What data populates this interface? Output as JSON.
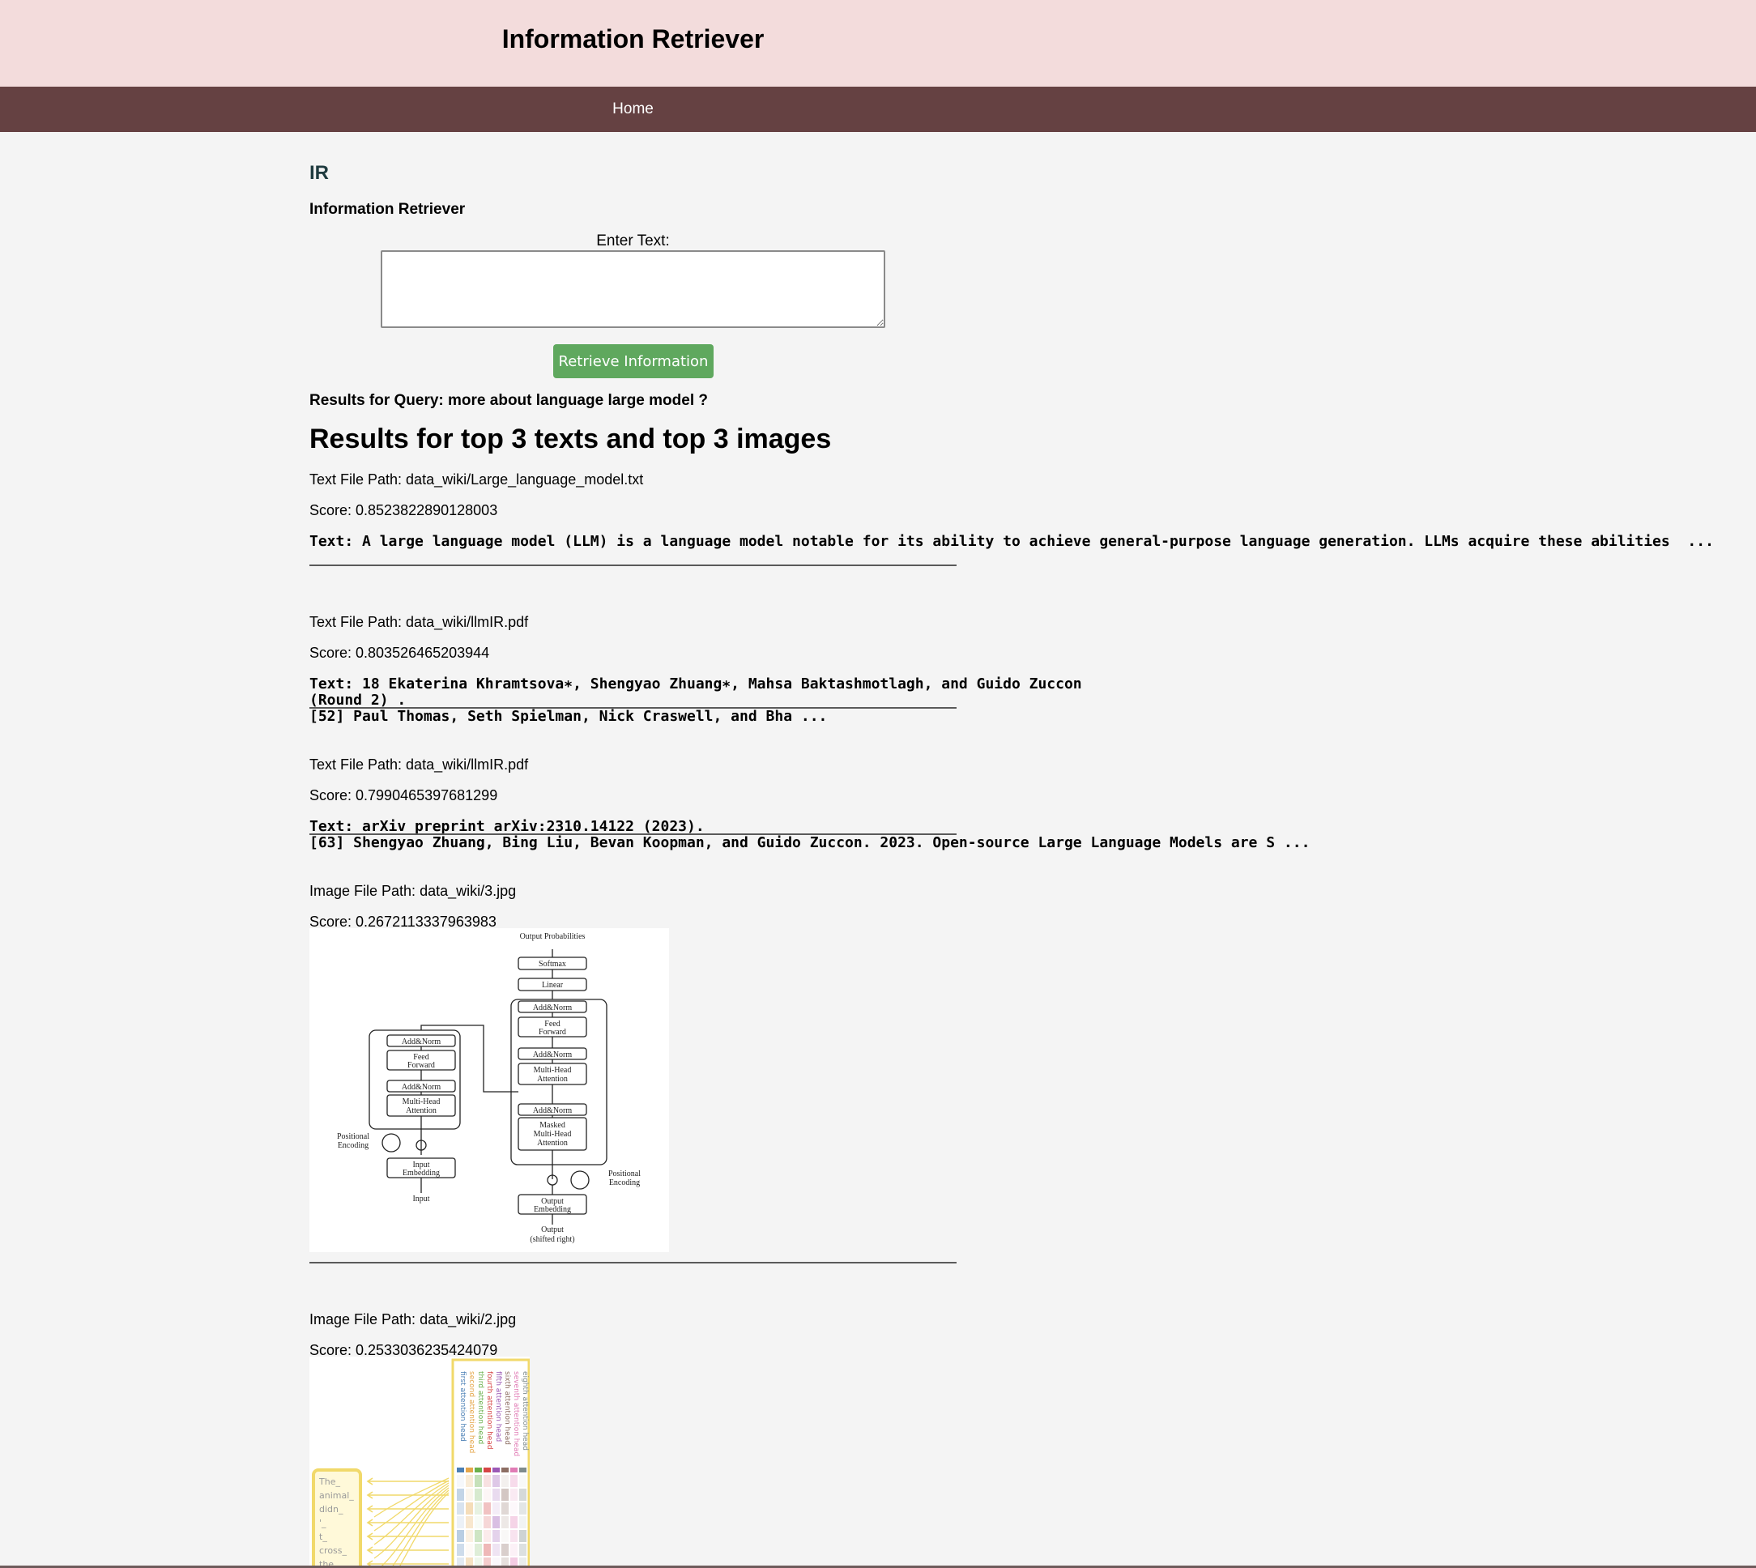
{
  "header": {
    "title": "Information Retriever"
  },
  "nav": {
    "home": "Home"
  },
  "main": {
    "section_heading": "IR",
    "subheading": "Information Retriever",
    "input_label": "Enter Text:",
    "input_value": "",
    "button_label": "Retrieve Information",
    "query_line": "Results for Query: more about language large model ?",
    "results_heading": "Results for top 3 texts and top 3 images"
  },
  "text_results": [
    {
      "path": "Text File Path: data_wiki/Large_language_model.txt",
      "score": "Score: 0.8523822890128003",
      "text": "Text: A large language model (LLM) is a language model notable for its ability to achieve general-purpose language generation. LLMs acquire these abilities  ..."
    },
    {
      "path": "Text File Path: data_wiki/llmIR.pdf",
      "score": "Score: 0.803526465203944",
      "text": "Text: 18 Ekaterina Khramtsova∗, Shengyao Zhuang∗, Mahsa Baktashmotlagh, and Guido Zuccon\n(Round 2) .\n[52] Paul Thomas, Seth Spielman, Nick Craswell, and Bha ..."
    },
    {
      "path": "Text File Path: data_wiki/llmIR.pdf",
      "score": "Score: 0.7990465397681299",
      "text": "Text: arXiv preprint arXiv:2310.14122 (2023).\n[63] Shengyao Zhuang, Bing Liu, Bevan Koopman, and Guido Zuccon. 2023. Open-source Large Language Models are S ..."
    }
  ],
  "image_results": [
    {
      "path": "Image File Path: data_wiki/3.jpg",
      "score": "Score: 0.2672113337963983",
      "diagram": {
        "output_probabilities": "Output Probabilities",
        "softmax": "Softmax",
        "linear": "Linear",
        "add_norm": "Add&Norm",
        "feed_forward_1": "Feed",
        "feed_forward_2": "Forward",
        "multi_head_1": "Multi-Head",
        "multi_head_2": "Attention",
        "masked": "Masked",
        "positional_1": "Positional",
        "positional_2": "Encoding",
        "input_embedding_1": "Input",
        "input_embedding_2": "Embedding",
        "input": "Input",
        "output_embedding_1": "Output",
        "output_embedding_2": "Embedding",
        "output_shifted_1": "Output",
        "output_shifted_2": "(shifted right)"
      }
    },
    {
      "path": "Image File Path: data_wiki/2.jpg",
      "score": "Score: 0.2533036235424079",
      "tokens": [
        "The_",
        "animal_",
        "didn_",
        "'_",
        "t_",
        "cross_",
        "the_"
      ],
      "heads": [
        "first attention head",
        "second attention head",
        "third attention head",
        "fourth attention head",
        "fifth attention head",
        "sixth attention head",
        "seventh attention head",
        "eighth attention head"
      ],
      "head_colors": [
        "#4a7fb5",
        "#e5a64a",
        "#6ab04c",
        "#d64545",
        "#9b59b6",
        "#8d6e63",
        "#e07bb5",
        "#7f8c8d"
      ]
    }
  ]
}
